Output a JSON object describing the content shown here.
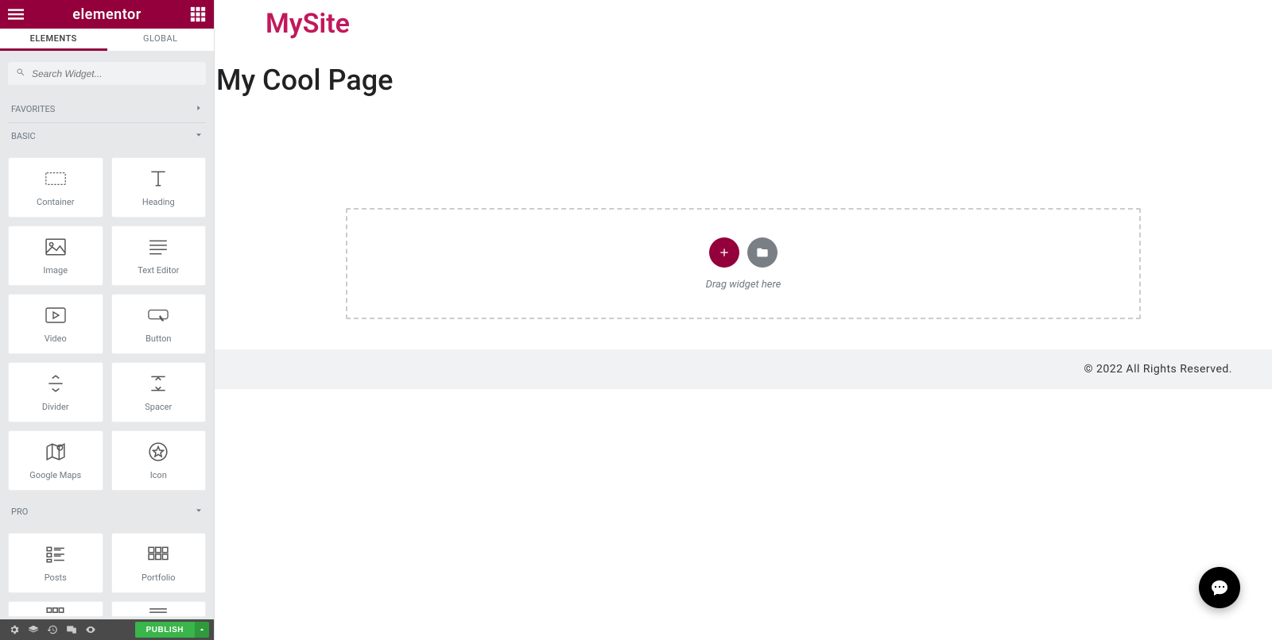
{
  "header": {
    "brand": "elementor"
  },
  "tabs": {
    "elements": "ELEMENTS",
    "global": "GLOBAL"
  },
  "search": {
    "placeholder": "Search Widget..."
  },
  "sections": {
    "favorites": "FAVORITES",
    "basic": "BASIC",
    "pro": "PRO"
  },
  "widgets": {
    "basic": [
      {
        "id": "container",
        "label": "Container"
      },
      {
        "id": "heading",
        "label": "Heading"
      },
      {
        "id": "image",
        "label": "Image"
      },
      {
        "id": "texteditor",
        "label": "Text Editor"
      },
      {
        "id": "video",
        "label": "Video"
      },
      {
        "id": "button",
        "label": "Button"
      },
      {
        "id": "divider",
        "label": "Divider"
      },
      {
        "id": "spacer",
        "label": "Spacer"
      },
      {
        "id": "maps",
        "label": "Google Maps"
      },
      {
        "id": "icon",
        "label": "Icon"
      }
    ],
    "pro": [
      {
        "id": "posts",
        "label": "Posts"
      },
      {
        "id": "portfolio",
        "label": "Portfolio"
      }
    ]
  },
  "bottom": {
    "publish": "PUBLISH"
  },
  "canvas": {
    "site_title": "MySite",
    "page_title": "My Cool Page",
    "drop_hint": "Drag widget here",
    "footer": "© 2022 All Rights Reserved."
  },
  "colors": {
    "accent": "#93003c"
  }
}
